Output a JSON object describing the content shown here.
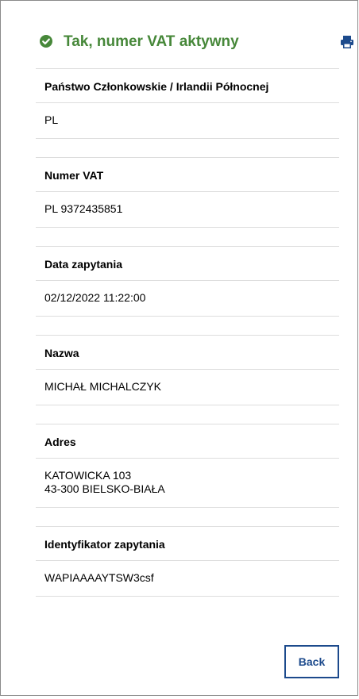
{
  "status": {
    "title": "Tak, numer VAT aktywny",
    "color": "#47883a",
    "icon": "check-circle-icon"
  },
  "toolbar": {
    "print_icon": "print-icon",
    "accent": "#1c4a8c"
  },
  "fields": [
    {
      "label": "Państwo Członkowskie / Irlandii Północnej",
      "value": "PL"
    },
    {
      "label": "Numer VAT",
      "value": "PL 9372435851"
    },
    {
      "label": "Data zapytania",
      "value": "02/12/2022 11:22:00"
    },
    {
      "label": "Nazwa",
      "value": "MICHAŁ MICHALCZYK"
    },
    {
      "label": "Adres",
      "value": "KATOWICKA 103\n43-300 BIELSKO-BIAŁA"
    },
    {
      "label": "Identyfikator zapytania",
      "value": "WAPIAAAAYTSW3csf"
    }
  ],
  "actions": {
    "back_label": "Back"
  }
}
